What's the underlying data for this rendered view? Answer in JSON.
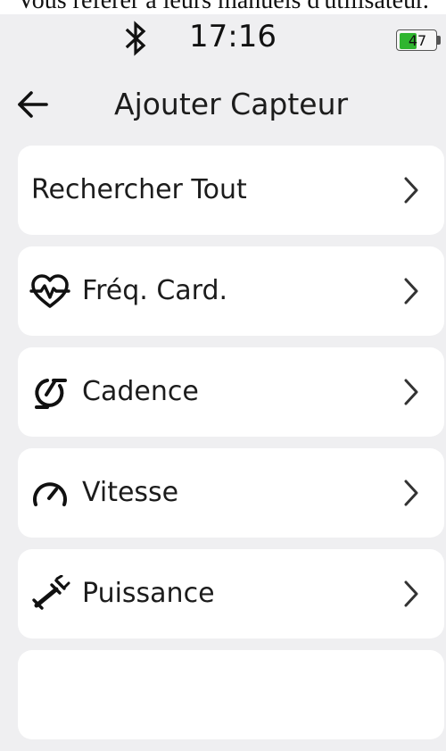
{
  "caption": "Vous référer à leurs manuels d'utilisateur.",
  "status_bar": {
    "bluetooth_icon": "bluetooth-icon",
    "time": "17:16",
    "battery_level": "47",
    "battery_color": "#2fb52f"
  },
  "header": {
    "back_icon": "arrow-left-icon",
    "title": "Ajouter Capteur"
  },
  "sensors": [
    {
      "label": "Rechercher Tout",
      "icon": null,
      "chevron": "chevron-right-icon"
    },
    {
      "label": "Fréq. Card.",
      "icon": "heart-rate-icon",
      "chevron": "chevron-right-icon"
    },
    {
      "label": "Cadence",
      "icon": "cadence-icon",
      "chevron": "chevron-right-icon"
    },
    {
      "label": "Vitesse",
      "icon": "speedometer-icon",
      "chevron": "chevron-right-icon"
    },
    {
      "label": "Puissance",
      "icon": "power-meter-icon",
      "chevron": "chevron-right-icon"
    }
  ]
}
